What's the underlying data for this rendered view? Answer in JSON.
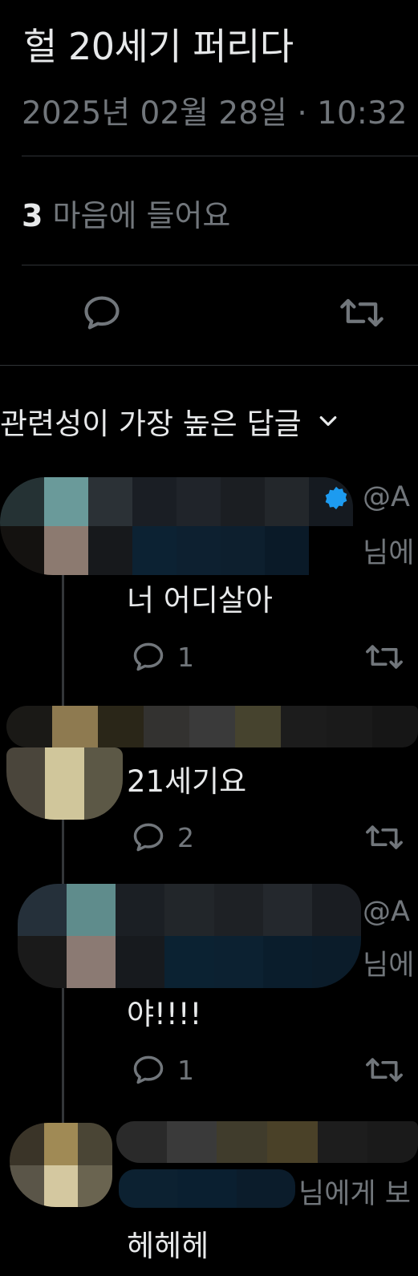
{
  "tweet": {
    "text": "헐 20세기 퍼리다",
    "timestamp": "2025년 02월 28일 · 10:32 ",
    "likes_count": "3",
    "likes_label": "마음에 들어요"
  },
  "replies_header": {
    "sort_label": "관련성이 가장 높은 답글"
  },
  "replies": [
    {
      "handle": "@A",
      "reply_to": "님에",
      "text": "너 어디살아",
      "reply_count": "1"
    },
    {
      "text": "21세기요",
      "reply_count": "2"
    },
    {
      "handle": "@A",
      "reply_to": "님에",
      "text": "야!!!!",
      "reply_count": "1"
    },
    {
      "reply_to": "님에게 보",
      "text": "헤헤헤"
    }
  ],
  "colors": {
    "background": "#000000",
    "text_primary": "#e7e9ea",
    "text_secondary": "#71767b",
    "divider": "#2f3336",
    "verified": "#1d9bf0"
  }
}
